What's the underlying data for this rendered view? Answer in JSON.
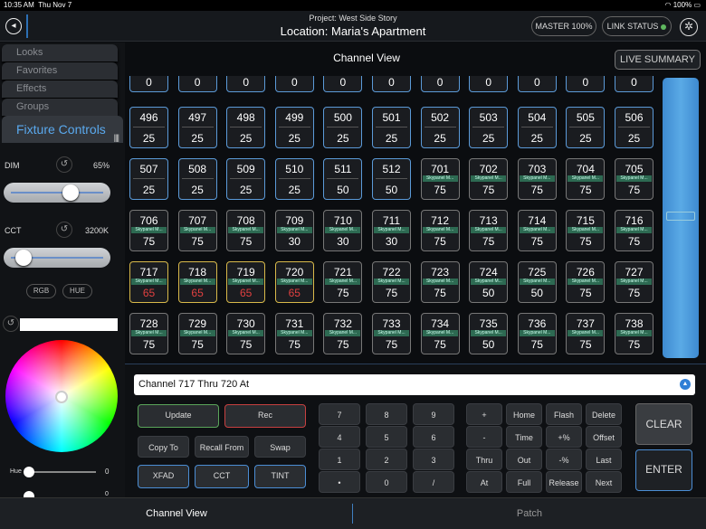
{
  "status": {
    "time": "10:35 AM",
    "date": "Thu Nov 7",
    "battery": "100%"
  },
  "header": {
    "project": "Project: West Side Story",
    "location": "Location: Maria's Apartment",
    "master": "MASTER 100%",
    "link": "LINK STATUS"
  },
  "sidebar": {
    "tabs": [
      "Looks",
      "Favorites",
      "Effects",
      "Groups"
    ],
    "active_tab": "Fixture Controls",
    "dim": {
      "label": "DIM",
      "value": "65%",
      "level": 0.65
    },
    "cct": {
      "label": "CCT",
      "value": "3200K",
      "level": 0.0
    },
    "rgb": "RGB",
    "hue": "HUE",
    "hue_label": "Hue",
    "hue_value": "0",
    "sat_value": "0"
  },
  "main": {
    "title": "Channel View",
    "live_summary": "LIVE SUMMARY"
  },
  "fixture_label": "Skypanel M...",
  "rows": [
    [
      {
        "n": "",
        "l": "0",
        "s": "b"
      },
      {
        "n": "",
        "l": "0",
        "s": "b"
      },
      {
        "n": "",
        "l": "0",
        "s": "b"
      },
      {
        "n": "",
        "l": "0",
        "s": "b"
      },
      {
        "n": "",
        "l": "0",
        "s": "b"
      },
      {
        "n": "",
        "l": "0",
        "s": "b"
      },
      {
        "n": "",
        "l": "0",
        "s": "b"
      },
      {
        "n": "",
        "l": "0",
        "s": "b"
      },
      {
        "n": "",
        "l": "0",
        "s": "b"
      },
      {
        "n": "",
        "l": "0",
        "s": "b"
      },
      {
        "n": "",
        "l": "0",
        "s": "b"
      }
    ],
    [
      {
        "n": "496",
        "l": "25",
        "s": "b"
      },
      {
        "n": "497",
        "l": "25",
        "s": "b"
      },
      {
        "n": "498",
        "l": "25",
        "s": "b"
      },
      {
        "n": "499",
        "l": "25",
        "s": "b"
      },
      {
        "n": "500",
        "l": "25",
        "s": "b"
      },
      {
        "n": "501",
        "l": "25",
        "s": "b"
      },
      {
        "n": "502",
        "l": "25",
        "s": "b"
      },
      {
        "n": "503",
        "l": "25",
        "s": "b"
      },
      {
        "n": "504",
        "l": "25",
        "s": "b"
      },
      {
        "n": "505",
        "l": "25",
        "s": "b"
      },
      {
        "n": "506",
        "l": "25",
        "s": "b"
      }
    ],
    [
      {
        "n": "507",
        "l": "25",
        "s": "b"
      },
      {
        "n": "508",
        "l": "25",
        "s": "b"
      },
      {
        "n": "509",
        "l": "25",
        "s": "b"
      },
      {
        "n": "510",
        "l": "25",
        "s": "b"
      },
      {
        "n": "511",
        "l": "50",
        "s": "b"
      },
      {
        "n": "512",
        "l": "50",
        "s": "b"
      },
      {
        "n": "701",
        "l": "75",
        "s": "g",
        "f": 1
      },
      {
        "n": "702",
        "l": "75",
        "s": "g",
        "f": 1
      },
      {
        "n": "703",
        "l": "75",
        "s": "g",
        "f": 1
      },
      {
        "n": "704",
        "l": "75",
        "s": "g",
        "f": 1
      },
      {
        "n": "705",
        "l": "75",
        "s": "g",
        "f": 1
      }
    ],
    [
      {
        "n": "706",
        "l": "75",
        "s": "g",
        "f": 1
      },
      {
        "n": "707",
        "l": "75",
        "s": "g",
        "f": 1
      },
      {
        "n": "708",
        "l": "75",
        "s": "g",
        "f": 1
      },
      {
        "n": "709",
        "l": "30",
        "s": "g",
        "f": 1
      },
      {
        "n": "710",
        "l": "30",
        "s": "g",
        "f": 1
      },
      {
        "n": "711",
        "l": "30",
        "s": "g",
        "f": 1
      },
      {
        "n": "712",
        "l": "75",
        "s": "g",
        "f": 1
      },
      {
        "n": "713",
        "l": "75",
        "s": "g",
        "f": 1
      },
      {
        "n": "714",
        "l": "75",
        "s": "g",
        "f": 1
      },
      {
        "n": "715",
        "l": "75",
        "s": "g",
        "f": 1
      },
      {
        "n": "716",
        "l": "75",
        "s": "g",
        "f": 1
      }
    ],
    [
      {
        "n": "717",
        "l": "65",
        "s": "y",
        "f": 1,
        "red": 1
      },
      {
        "n": "718",
        "l": "65",
        "s": "y",
        "f": 1,
        "red": 1
      },
      {
        "n": "719",
        "l": "65",
        "s": "y",
        "f": 1,
        "red": 1
      },
      {
        "n": "720",
        "l": "65",
        "s": "y",
        "f": 1,
        "red": 1
      },
      {
        "n": "721",
        "l": "75",
        "s": "g",
        "f": 1
      },
      {
        "n": "722",
        "l": "75",
        "s": "g",
        "f": 1
      },
      {
        "n": "723",
        "l": "75",
        "s": "g",
        "f": 1
      },
      {
        "n": "724",
        "l": "50",
        "s": "g",
        "f": 1
      },
      {
        "n": "725",
        "l": "50",
        "s": "g",
        "f": 1
      },
      {
        "n": "726",
        "l": "75",
        "s": "g",
        "f": 1
      },
      {
        "n": "727",
        "l": "75",
        "s": "g",
        "f": 1
      }
    ],
    [
      {
        "n": "728",
        "l": "75",
        "s": "g",
        "f": 1
      },
      {
        "n": "729",
        "l": "75",
        "s": "g",
        "f": 1
      },
      {
        "n": "730",
        "l": "75",
        "s": "g",
        "f": 1
      },
      {
        "n": "731",
        "l": "75",
        "s": "g",
        "f": 1
      },
      {
        "n": "732",
        "l": "75",
        "s": "g",
        "f": 1
      },
      {
        "n": "733",
        "l": "75",
        "s": "g",
        "f": 1
      },
      {
        "n": "734",
        "l": "75",
        "s": "g",
        "f": 1
      },
      {
        "n": "735",
        "l": "50",
        "s": "g",
        "f": 1
      },
      {
        "n": "736",
        "l": "75",
        "s": "g",
        "f": 1
      },
      {
        "n": "737",
        "l": "75",
        "s": "g",
        "f": 1
      },
      {
        "n": "738",
        "l": "75",
        "s": "g",
        "f": 1
      }
    ]
  ],
  "command": {
    "text": "Channel 717 Thru 720 At"
  },
  "buttons": {
    "update": "Update",
    "rec": "Rec",
    "copy_to": "Copy To",
    "recall_from": "Recall From",
    "swap": "Swap",
    "xfad": "XFAD",
    "cct": "CCT",
    "tint": "TINT",
    "k7": "7",
    "k8": "8",
    "k9": "9",
    "k4": "4",
    "k5": "5",
    "k6": "6",
    "k1": "1",
    "k2": "2",
    "k3": "3",
    "kdot": "•",
    "k0": "0",
    "kslash": "/",
    "plus": "+",
    "home": "Home",
    "flash": "Flash",
    "delete": "Delete",
    "minus": "-",
    "time": "Time",
    "plus_pct": "+%",
    "offset": "Offset",
    "thru": "Thru",
    "out": "Out",
    "minus_pct": "-%",
    "last": "Last",
    "at": "At",
    "full": "Full",
    "release": "Release",
    "next": "Next",
    "clear": "CLEAR",
    "enter": "ENTER"
  },
  "bottom_tabs": {
    "channel_view": "Channel View",
    "patch": "Patch"
  }
}
